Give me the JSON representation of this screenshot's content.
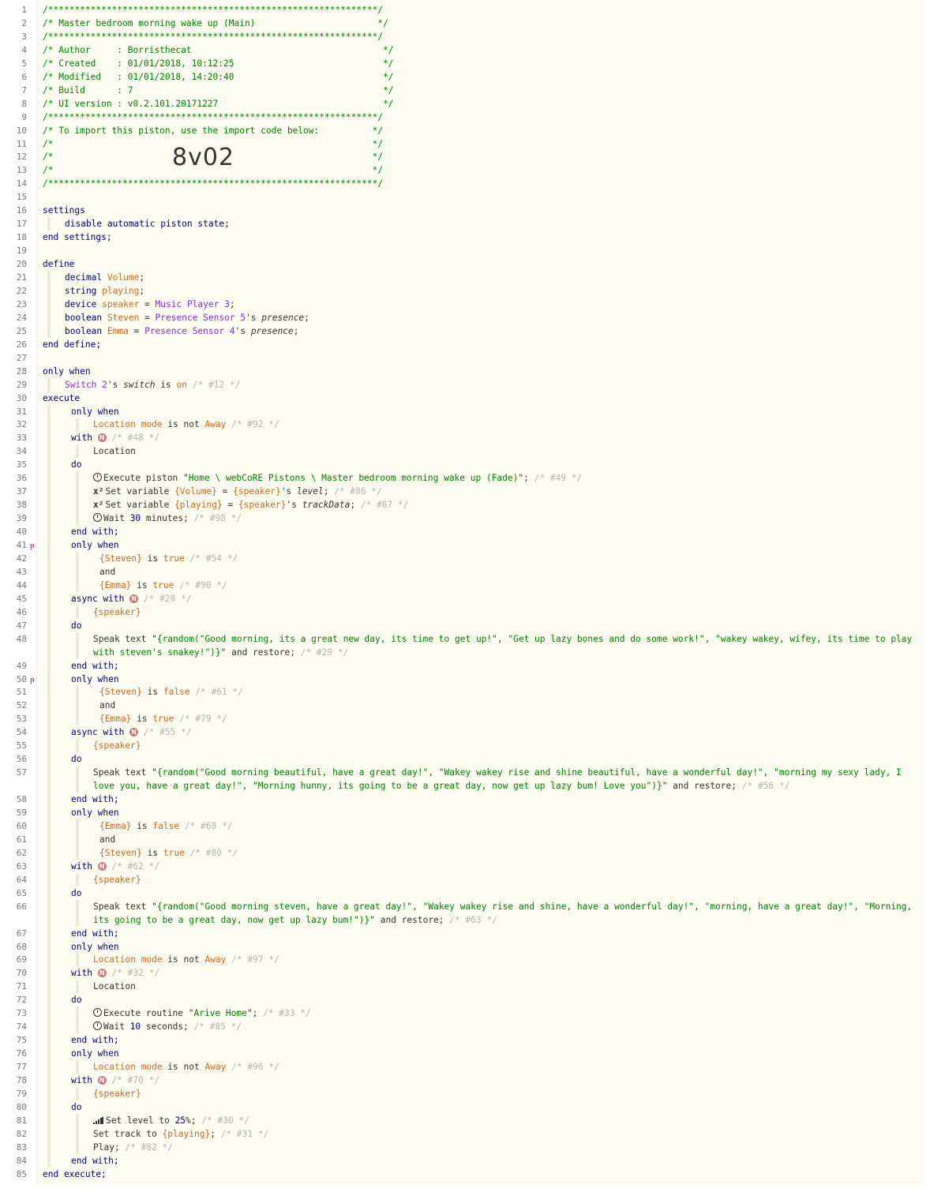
{
  "gutter_markers": {
    "l41": "ᵽ",
    "l50": "ᵽ"
  },
  "import_code": "8v02",
  "comments": {
    "l1": "/**************************************************************/",
    "l2": "/* Master bedroom morning wake up (Main)                       */",
    "l3": "/**************************************************************/",
    "l4": "/* Author     : Borristhecat                                    */",
    "l5": "/* Created    : 01/01/2018, 10:12:25                            */",
    "l6": "/* Modified   : 01/01/2018, 14:20:40                            */",
    "l7": "/* Build      : 7                                               */",
    "l8": "/* UI version : v0.2.101.20171227                               */",
    "l9": "/**************************************************************/",
    "l10": "/* To import this piston, use the import code below:          */",
    "l11": "/*                                                            */",
    "l12": "/*                                                            */",
    "l13": "/*                                                            */",
    "l14": "/**************************************************************/"
  },
  "code": {
    "settings": "settings",
    "disable": "disable automatic piston state;",
    "end_settings": "end settings;",
    "define": "define",
    "decimal": "decimal",
    "volume": "Volume",
    "semi": ";",
    "string": "string",
    "playing": "playing",
    "device": "device",
    "speaker": "speaker",
    "eq": " = ",
    "music_player": "Music Player 3",
    "boolean": "boolean",
    "steven": "Steven",
    "emma": "Emma",
    "presence5": "Presence Sensor 5",
    "presence4": "Presence Sensor 4",
    "apos_s": "'s ",
    "presence": "presence",
    "end_define": "end define;",
    "only_when": "only when",
    "switch2": "Switch 2",
    "switch": "switch",
    "is": " is ",
    "on": "on",
    "id12": "/* #12 */",
    "execute": "execute",
    "location_mode": "Location mode",
    "is_not": " is not ",
    "away": "Away",
    "id92": "/* #92 */",
    "with": "with",
    "async_with": "async with",
    "nbadge": "N",
    "id48": "/* #48 */",
    "location": "Location",
    "do": "do",
    "exec_piston": "Execute piston \"",
    "piston_path": "Home \\ webCoRE Pistons \\ Master bedroom morning wake up (Fade)",
    "close_quote_semi": "\";",
    "id49": "/* #49 */",
    "xsq": "x²",
    "set_variable": "Set variable ",
    "volume_var": "{Volume}",
    "speaker_var": "{speaker}",
    "level": "level",
    "id86": "/* #86 */",
    "playing_var": "{playing}",
    "trackdata": "trackData",
    "id87": "/* #87 */",
    "wait": "Wait ",
    "n30": "30",
    "minutes": " minutes;",
    "id98": "/* #98 */",
    "end_with": "end with;",
    "steven_var": "{Steven}",
    "emma_var": "{Emma}",
    "is_true": "true",
    "is_false": "false",
    "and": "and",
    "id54": "/* #54 */",
    "id90": "/* #90 */",
    "id28": "/* #28 */",
    "speak_text": "Speak text \"",
    "speak48a": "{random(\"Good morning, its a great new day, its time to get up!\", \"Get up lazy bones and do some work!\", \"wakey wakey, wifey, its time to play",
    "speak48b": "with steven's snakey!\")}",
    "and_restore": "\" and restore; ",
    "id29": "/* #29 */",
    "id61": "/* #61 */",
    "id79": "/* #79 */",
    "id55": "/* #55 */",
    "speak57a": "{random(\"Good morning beautiful, have a great day!\", \"Wakey wakey rise and shine beautiful, have a wonderful day!\", \"morning my sexy lady, I",
    "speak57b": "love you, have a great day!\", \"Morning hunny, its going to be a great day, now get up lazy bum! Love you\")}",
    "id56": "/* #56 */",
    "id68": "/* #68 */",
    "id80": "/* #80 */",
    "id62": "/* #62 */",
    "speak66a": "{random(\"Good morning steven, have a great day!\", \"Wakey wakey rise and shine, have a wonderful day!\", \"morning, have a great day!\", \"Morning,",
    "speak66b": "its going to be a great day, now get up lazy bum!\")}",
    "id63": "/* #63 */",
    "id97": "/* #97 */",
    "id32": "/* #32 */",
    "exec_routine": "Execute routine \"",
    "arive_home": "Arive Home",
    "id33": "/* #33 */",
    "n10": "10",
    "seconds": " seconds;",
    "id85": "/* #85 */",
    "id96": "/* #96 */",
    "id70": "/* #70 */",
    "set_level": "Set level to ",
    "pct25": "25",
    "pct_semi": "%; ",
    "id30": "/* #30 */",
    "set_track": "Set track to ",
    "id31": "/* #31 */",
    "play": "Play; ",
    "id82": "/* #82 */",
    "end_execute": "end execute;"
  }
}
